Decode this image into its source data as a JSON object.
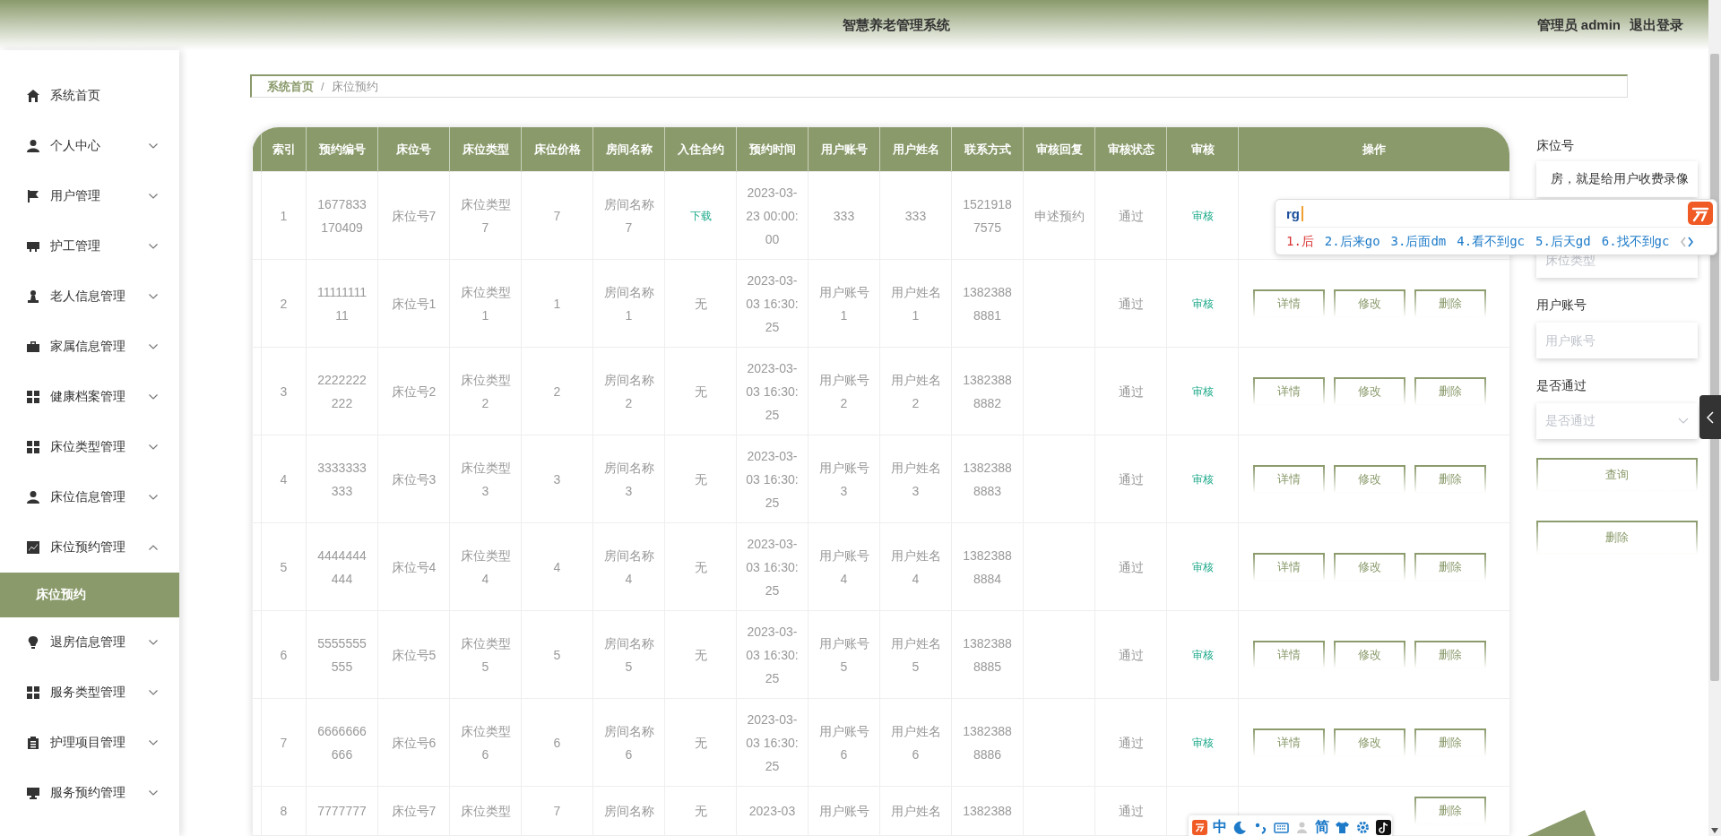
{
  "header": {
    "title": "智慧养老管理系统",
    "user": "管理员 admin",
    "logout": "退出登录"
  },
  "sidebar": {
    "items": [
      {
        "label": "系统首页"
      },
      {
        "label": "个人中心",
        "expanded": false
      },
      {
        "label": "用户管理",
        "expanded": false
      },
      {
        "label": "护工管理",
        "expanded": false
      },
      {
        "label": "老人信息管理",
        "expanded": false
      },
      {
        "label": "家属信息管理",
        "expanded": false
      },
      {
        "label": "健康档案管理",
        "expanded": false
      },
      {
        "label": "床位类型管理",
        "expanded": false
      },
      {
        "label": "床位信息管理",
        "expanded": false
      },
      {
        "label": "床位预约管理",
        "expanded": true,
        "children": [
          {
            "label": "床位预约",
            "selected": true
          }
        ]
      },
      {
        "label": "退房信息管理",
        "expanded": false
      },
      {
        "label": "服务类型管理",
        "expanded": false
      },
      {
        "label": "护理项目管理",
        "expanded": false
      },
      {
        "label": "服务预约管理",
        "expanded": false
      }
    ]
  },
  "breadcrumb": {
    "home": "系统首页",
    "separator": "/",
    "current": "床位预约"
  },
  "table": {
    "columns": [
      "索引",
      "预约编号",
      "床位号",
      "床位类型",
      "床位价格",
      "房间名称",
      "入住合约",
      "预约时间",
      "用户账号",
      "用户姓名",
      "联系方式",
      "审核回复",
      "审核状态",
      "审核",
      "操作"
    ],
    "rows": [
      {
        "index": "1",
        "code": "1677833170409",
        "bed": "床位号7",
        "bed_type": "床位类型7",
        "price": "7",
        "room": "房间名称7",
        "contract": {
          "text": "下载",
          "kind": "link"
        },
        "time": "2023-03-23 00:00:00",
        "account": "333",
        "name": "333",
        "phone": "15219187575",
        "reply": "申述预约",
        "status": "通过",
        "audit": "审核"
      },
      {
        "index": "2",
        "code": "1111111111",
        "bed": "床位号1",
        "bed_type": "床位类型1",
        "price": "1",
        "room": "房间名称1",
        "contract": {
          "text": "无",
          "kind": "plain"
        },
        "time": "2023-03-03 16:30:25",
        "account": "用户账号1",
        "name": "用户姓名1",
        "phone": "13823888881",
        "status": "通过",
        "audit": "审核",
        "actions": [
          "详情",
          "修改",
          "删除"
        ]
      },
      {
        "index": "3",
        "code": "2222222222",
        "bed": "床位号2",
        "bed_type": "床位类型2",
        "price": "2",
        "room": "房间名称2",
        "contract": {
          "text": "无",
          "kind": "plain"
        },
        "time": "2023-03-03 16:30:25",
        "account": "用户账号2",
        "name": "用户姓名2",
        "phone": "13823888882",
        "status": "通过",
        "audit": "审核",
        "actions": [
          "详情",
          "修改",
          "删除"
        ]
      },
      {
        "index": "4",
        "code": "3333333333",
        "bed": "床位号3",
        "bed_type": "床位类型3",
        "price": "3",
        "room": "房间名称3",
        "contract": {
          "text": "无",
          "kind": "plain"
        },
        "time": "2023-03-03 16:30:25",
        "account": "用户账号3",
        "name": "用户姓名3",
        "phone": "13823888883",
        "status": "通过",
        "audit": "审核",
        "actions": [
          "详情",
          "修改",
          "删除"
        ]
      },
      {
        "index": "5",
        "code": "4444444444",
        "bed": "床位号4",
        "bed_type": "床位类型4",
        "price": "4",
        "room": "房间名称4",
        "contract": {
          "text": "无",
          "kind": "plain"
        },
        "time": "2023-03-03 16:30:25",
        "account": "用户账号4",
        "name": "用户姓名4",
        "phone": "13823888884",
        "status": "通过",
        "audit": "审核",
        "actions": [
          "详情",
          "修改",
          "删除"
        ]
      },
      {
        "index": "6",
        "code": "5555555555",
        "bed": "床位号5",
        "bed_type": "床位类型5",
        "price": "5",
        "room": "房间名称5",
        "contract": {
          "text": "无",
          "kind": "plain"
        },
        "time": "2023-03-03 16:30:25",
        "account": "用户账号5",
        "name": "用户姓名5",
        "phone": "13823888885",
        "status": "通过",
        "audit": "审核",
        "actions": [
          "详情",
          "修改",
          "删除"
        ]
      },
      {
        "index": "7",
        "code": "6666666666",
        "bed": "床位号6",
        "bed_type": "床位类型6",
        "price": "6",
        "room": "房间名称6",
        "contract": {
          "text": "无",
          "kind": "plain"
        },
        "time": "2023-03-03 16:30:25",
        "account": "用户账号6",
        "name": "用户姓名6",
        "phone": "13823888886",
        "status": "通过",
        "audit": "审核",
        "actions": [
          "详情",
          "修改",
          "删除"
        ]
      },
      {
        "index": "8",
        "code": "7777777",
        "bed": "床位号7",
        "bed_type": "床位类型",
        "price": "7",
        "room": "房间名称",
        "contract": {
          "text": "无",
          "kind": "plain"
        },
        "time": "2023-03",
        "account": "用户账号",
        "name": "用户姓名",
        "phone": "1382388",
        "status": "通过",
        "actions": [
          "删除"
        ]
      }
    ]
  },
  "filters": [
    {
      "kind": "input",
      "label": "床位号",
      "value": "房，就是给用户收费录像"
    },
    {
      "kind": "input",
      "placeholder": "床位类型"
    },
    {
      "kind": "input",
      "label": "用户账号",
      "placeholder": "用户账号"
    },
    {
      "kind": "select",
      "label": "是否通过",
      "placeholder": "是否通过"
    }
  ],
  "filter_buttons": [
    "查询",
    "删除"
  ],
  "ime": {
    "composition": "rg",
    "candidates": [
      {
        "text": "1.后",
        "selected": true
      },
      {
        "text": "2.后来go",
        "selected": false
      },
      {
        "text": "3.后面dm",
        "selected": false
      },
      {
        "text": "4.看不到gc",
        "selected": false
      },
      {
        "text": "5.后天gd",
        "selected": false
      },
      {
        "text": "6.找不到gc",
        "selected": false
      }
    ],
    "toolbar": {
      "mode": "中",
      "script": "简"
    }
  }
}
